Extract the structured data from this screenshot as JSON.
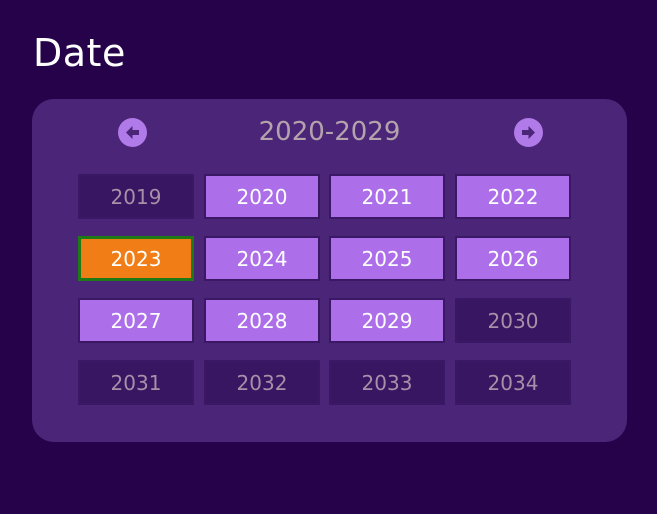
{
  "page": {
    "title": "Date"
  },
  "picker": {
    "range_label": "2020-2029",
    "prev_icon": "arrow-left-icon",
    "next_icon": "arrow-right-icon",
    "years": [
      {
        "label": "2019",
        "state": "out-range"
      },
      {
        "label": "2020",
        "state": "in-range"
      },
      {
        "label": "2021",
        "state": "in-range"
      },
      {
        "label": "2022",
        "state": "in-range"
      },
      {
        "label": "2023",
        "state": "selected"
      },
      {
        "label": "2024",
        "state": "in-range"
      },
      {
        "label": "2025",
        "state": "in-range"
      },
      {
        "label": "2026",
        "state": "in-range"
      },
      {
        "label": "2027",
        "state": "in-range"
      },
      {
        "label": "2028",
        "state": "in-range"
      },
      {
        "label": "2029",
        "state": "in-range"
      },
      {
        "label": "2030",
        "state": "out-range"
      },
      {
        "label": "2031",
        "state": "out-range"
      },
      {
        "label": "2032",
        "state": "out-range"
      },
      {
        "label": "2033",
        "state": "out-range"
      },
      {
        "label": "2034",
        "state": "out-range"
      }
    ]
  },
  "colors": {
    "background": "#25024a",
    "panel": "#4b2577",
    "in_range": "#ad6fe9",
    "out_range": "#381661",
    "selected": "#f07d16",
    "selected_border": "#1f7a16",
    "nav_button": "#b07ae8"
  }
}
